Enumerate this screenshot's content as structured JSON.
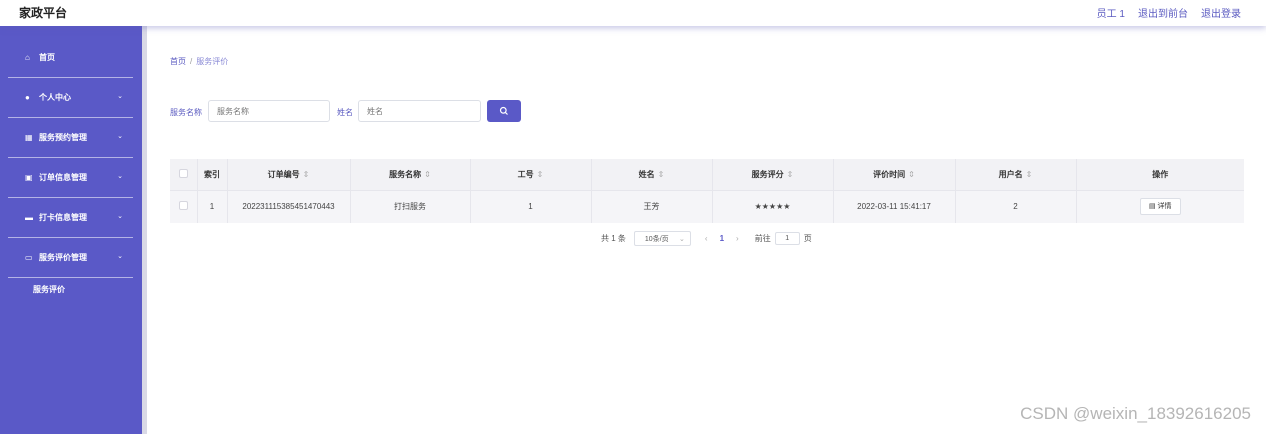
{
  "header": {
    "brand": "家政平台",
    "user": "员工 1",
    "back_front": "退出到前台",
    "logout": "退出登录"
  },
  "sidebar": {
    "items": [
      {
        "label": "首页",
        "icon": "home-icon",
        "glyph": "⌂",
        "expandable": false
      },
      {
        "label": "个人中心",
        "icon": "person-icon",
        "glyph": "👤",
        "expandable": true
      },
      {
        "label": "服务预约管理",
        "icon": "grid-icon",
        "glyph": "▦",
        "expandable": true
      },
      {
        "label": "订单信息管理",
        "icon": "lock-icon",
        "glyph": "▣",
        "expandable": true
      },
      {
        "label": "打卡信息管理",
        "icon": "card-icon",
        "glyph": "▬",
        "expandable": true
      },
      {
        "label": "服务评价管理",
        "icon": "briefcase-icon",
        "glyph": "▭",
        "expandable": true
      }
    ],
    "submenu": "服务评价",
    "chevron": "⌄"
  },
  "breadcrumb": {
    "home": "首页",
    "separator": "/",
    "current": "服务评价"
  },
  "search": {
    "service_name_label": "服务名称",
    "service_name_placeholder": "服务名称",
    "name_label": "姓名",
    "name_placeholder": "姓名",
    "search_icon": "search-icon"
  },
  "table": {
    "headers": [
      "索引",
      "订单编号",
      "服务名称",
      "工号",
      "姓名",
      "服务评分",
      "评价时间",
      "用户名",
      "操作"
    ],
    "sort_glyph": "⇕",
    "rows": [
      {
        "index": "1",
        "order_no": "20223111538545147044 3",
        "service_name": "打扫服务",
        "staff_no": "1",
        "name": "王芳",
        "rating": "★★★★★",
        "time": "2022-03-11 15:41:17",
        "username": "2",
        "action": "详情"
      }
    ]
  },
  "pagination": {
    "total": "共 1 条",
    "page_size": "10条/页",
    "prev": "‹",
    "current_page": "1",
    "next": "›",
    "goto_label": "前往",
    "goto_value": "1",
    "page_suffix": "页"
  },
  "watermark": "CSDN @weixin_18392616205",
  "colors": {
    "accent": "#5a59c7",
    "sidebar": "#5a59c7"
  }
}
